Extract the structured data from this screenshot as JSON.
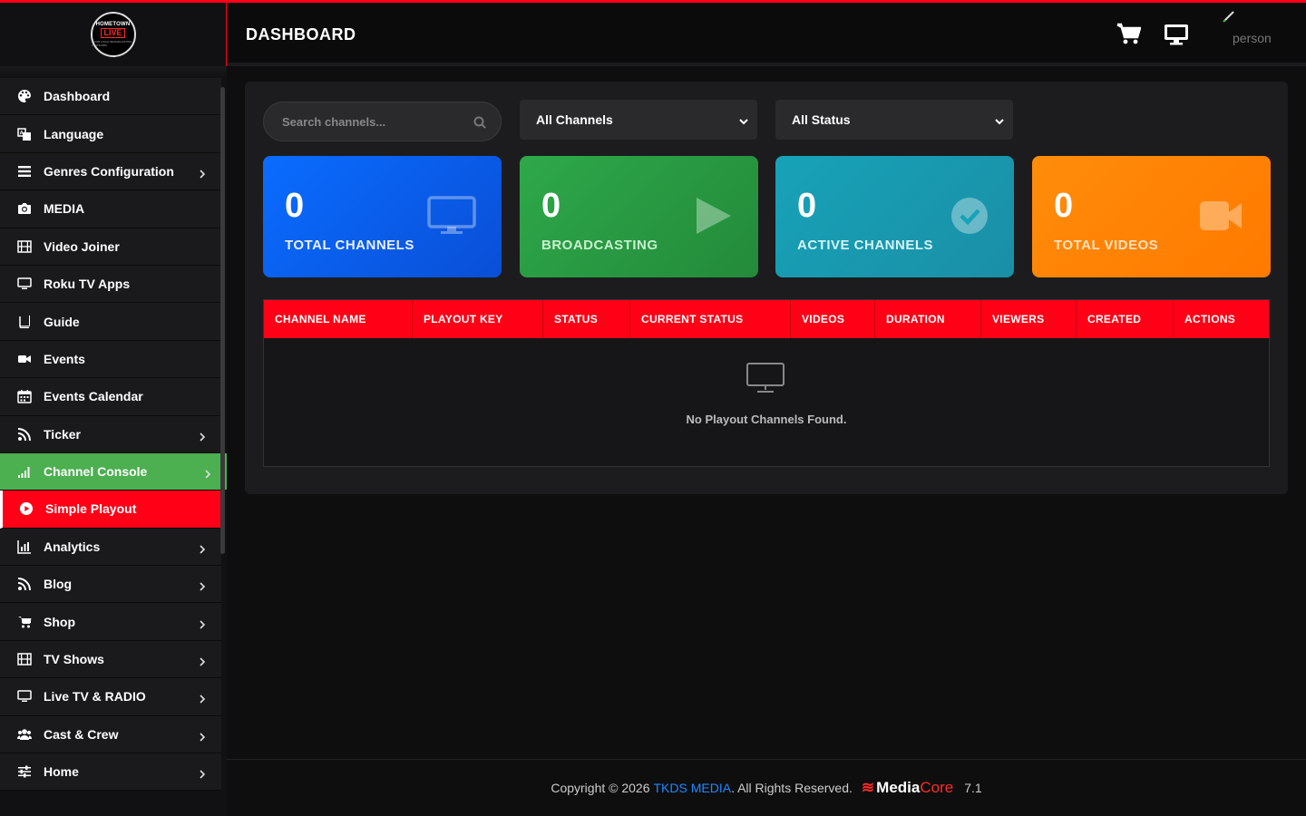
{
  "app": {
    "logo_line1": "HOMETOWN",
    "logo_line2": "LIVE",
    "logo_line3": "YOUR LOCAL BROADCASTING PLATFORM"
  },
  "header": {
    "title": "DASHBOARD",
    "user_name": "person",
    "cart_icon": "cart-icon",
    "monitor_icon": "desktop-icon"
  },
  "sidebar": {
    "items": [
      {
        "label": "Dashboard",
        "icon": "palette-icon",
        "chevron": false
      },
      {
        "label": "Language",
        "icon": "language-icon",
        "chevron": false
      },
      {
        "label": "Genres Configuration",
        "icon": "list-icon",
        "chevron": true
      },
      {
        "label": "MEDIA",
        "icon": "camera-icon",
        "chevron": false
      },
      {
        "label": "Video Joiner",
        "icon": "film-icon",
        "chevron": false
      },
      {
        "label": "Roku TV Apps",
        "icon": "monitor-icon",
        "chevron": false
      },
      {
        "label": "Guide",
        "icon": "book-icon",
        "chevron": false
      },
      {
        "label": "Events",
        "icon": "video-icon",
        "chevron": false
      },
      {
        "label": "Events Calendar",
        "icon": "calendar-icon",
        "chevron": false
      },
      {
        "label": "Ticker",
        "icon": "rss-icon",
        "chevron": true
      },
      {
        "label": "Channel Console",
        "icon": "signal-icon",
        "chevron": true,
        "state": "green"
      },
      {
        "label": "Simple Playout",
        "icon": "play-circle-icon",
        "chevron": false,
        "state": "active"
      },
      {
        "label": "Analytics",
        "icon": "bar-chart-icon",
        "chevron": true
      },
      {
        "label": "Blog",
        "icon": "rss-icon",
        "chevron": true
      },
      {
        "label": "Shop",
        "icon": "cart-icon",
        "chevron": true
      },
      {
        "label": "TV Shows",
        "icon": "film-icon",
        "chevron": true
      },
      {
        "label": "Live TV & RADIO",
        "icon": "monitor-icon",
        "chevron": true
      },
      {
        "label": "Cast & Crew",
        "icon": "users-icon",
        "chevron": true
      },
      {
        "label": "Home",
        "icon": "sliders-icon",
        "chevron": true
      }
    ]
  },
  "filters": {
    "search_placeholder": "Search channels...",
    "channel_select": "All Channels",
    "status_select": "All Status"
  },
  "stats": [
    {
      "value": "0",
      "label": "TOTAL CHANNELS",
      "icon": "desktop-icon",
      "color": "#0a6cff"
    },
    {
      "value": "0",
      "label": "BROADCASTING",
      "icon": "play-icon",
      "color": "#2ea84a"
    },
    {
      "value": "0",
      "label": "ACTIVE CHANNELS",
      "icon": "check-circle-icon",
      "color": "#17a2b8"
    },
    {
      "value": "0",
      "label": "TOTAL VIDEOS",
      "icon": "video-camera-icon",
      "color": "#ff8c0a"
    }
  ],
  "table": {
    "columns": [
      "CHANNEL NAME",
      "PLAYOUT KEY",
      "STATUS",
      "CURRENT STATUS",
      "VIDEOS",
      "DURATION",
      "VIEWERS",
      "CREATED",
      "ACTIONS"
    ],
    "empty_text": "No Playout Channels Found.",
    "empty_icon": "desktop-icon"
  },
  "footer": {
    "copyright": "Copyright © 2026",
    "company": "TKDS MEDIA",
    "rights": ". All Rights Reserved.",
    "brand_part1": "Media",
    "brand_part2": "Core",
    "version": "7.1"
  },
  "colors": {
    "accent_red": "#ff0016",
    "accent_green": "#4caf50",
    "link_blue": "#1e88ff"
  }
}
